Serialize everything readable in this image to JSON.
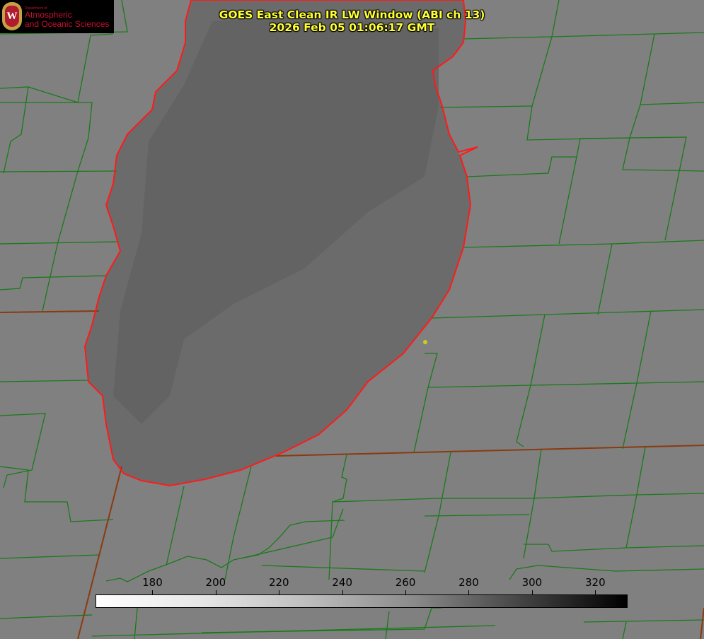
{
  "title": {
    "line1": "GOES East Clean IR LW Window (ABI ch 13)",
    "line2": "2026 Feb 05 01:06:17 GMT"
  },
  "logo": {
    "dept": "Department of",
    "line1": "Atmospheric",
    "line2": "and Oceanic Sciences",
    "crest_letter": "W"
  },
  "colorbar": {
    "ticks": [
      "180",
      "200",
      "220",
      "240",
      "260",
      "280",
      "300",
      "320"
    ],
    "range": [
      162,
      330
    ],
    "colormap": "white-to-black (cold bright, warm dark)"
  },
  "colors": {
    "land": "#808080",
    "lake": "#6b6b6b",
    "shoreline": "#ff1a1a",
    "county_lines": "#1a7a1a",
    "title_text": "#ffff33",
    "marker": "#cccc22"
  }
}
